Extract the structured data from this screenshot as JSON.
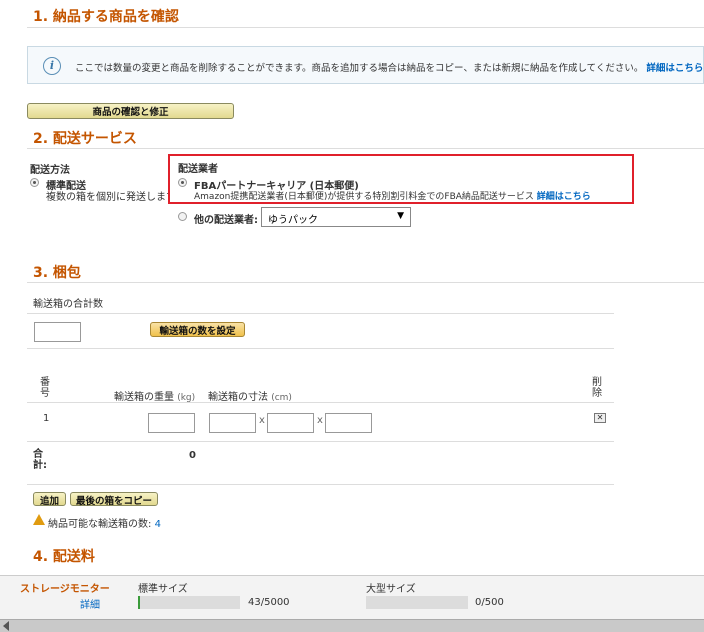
{
  "section1": {
    "title": "1. 納品する商品を確認",
    "info_text": "ここでは数量の変更と商品を削除することができます。商品を追加する場合は納品をコピー、または新規に納品を作成してください。",
    "info_link": "詳細はこちら",
    "confirm_button": "商品の確認と修正"
  },
  "section2": {
    "title": "2. 配送サービス",
    "method_label": "配送方法",
    "method_option": "標準配送",
    "method_desc": "複数の箱を個別に発送します",
    "carrier_label": "配送業者",
    "partner_carrier": "FBAパートナーキャリア (日本郵便)",
    "partner_desc": "Amazon提携配送業者(日本郵便)が提供する特別割引料金でのFBA納品配送サービス",
    "partner_link": "詳細はこちら",
    "other_carrier_label": "他の配送業者:",
    "other_carrier_value": "ゆうパック"
  },
  "section3": {
    "title": "3. 梱包",
    "box_total_label": "輸送箱の合計数",
    "set_boxes_button": "輸送箱の数を設定",
    "col_number": "番号",
    "col_weight": "輸送箱の重量",
    "col_weight_unit": "(kg)",
    "col_dims": "輸送箱の寸法",
    "col_dims_unit": "(cm)",
    "col_delete": "削除",
    "row_number": "1",
    "times": "x",
    "total_label": "合計:",
    "total_value": "0",
    "add_button": "追加",
    "copy_last_button": "最後の箱をコピー",
    "available_label": "納品可能な輸送箱の数:",
    "available_value": "4"
  },
  "section4": {
    "title": "4. 配送料"
  },
  "footer": {
    "storage_monitor": "ストレージモニター",
    "details": "詳細",
    "standard_label": "標準サイズ",
    "standard_count": "43/5000",
    "standard_fraction": 0.0086,
    "large_label": "大型サイズ",
    "large_count": "0/500",
    "large_fraction": 0
  },
  "colors": {
    "section_title": "#c45500",
    "link": "#0066c0",
    "highlight_border": "#e0202b",
    "warning": "#e09b10"
  }
}
